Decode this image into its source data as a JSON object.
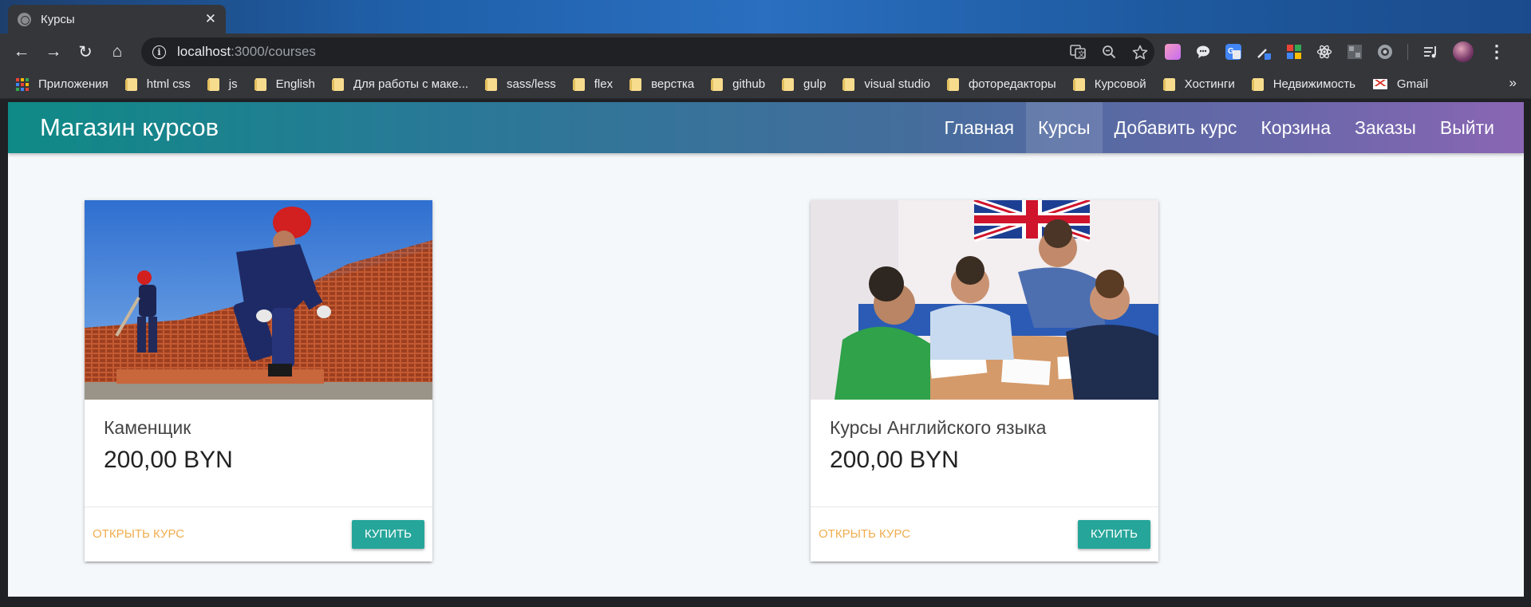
{
  "browser": {
    "tab": {
      "title": "Курсы",
      "close_glyph": "✕",
      "favicon": "globe-icon"
    },
    "nav": {
      "back": "←",
      "forward": "→",
      "reload": "↻",
      "home": "⌂"
    },
    "url": {
      "host": "localhost",
      "path": ":3000/courses"
    },
    "omnibox_icons": [
      "translate-icon",
      "zoom-icon",
      "star-icon"
    ],
    "extensions": [
      "gradient-extension-icon",
      "chat-extension-icon",
      "translate-extension-icon",
      "eyedropper-extension-icon",
      "grid-extension-icon",
      "react-devtools-icon",
      "layout-extension-icon",
      "circle-extension-icon"
    ],
    "bookmarks": [
      {
        "label": "Приложения",
        "type": "apps"
      },
      {
        "label": "html css",
        "type": "folder"
      },
      {
        "label": "js",
        "type": "folder"
      },
      {
        "label": "English",
        "type": "folder"
      },
      {
        "label": "Для работы с маке...",
        "type": "folder"
      },
      {
        "label": "sass/less",
        "type": "folder"
      },
      {
        "label": "flex",
        "type": "folder"
      },
      {
        "label": "верстка",
        "type": "folder"
      },
      {
        "label": "github",
        "type": "folder"
      },
      {
        "label": "gulp",
        "type": "folder"
      },
      {
        "label": "visual studio",
        "type": "folder"
      },
      {
        "label": "фоторедакторы",
        "type": "folder"
      },
      {
        "label": "Курсовой",
        "type": "folder"
      },
      {
        "label": "Хостинги",
        "type": "folder"
      },
      {
        "label": "Недвижимость",
        "type": "folder"
      },
      {
        "label": "Gmail",
        "type": "gmail"
      }
    ],
    "bookmarks_more": "»"
  },
  "navbar": {
    "brand": "Магазин курсов",
    "links": [
      {
        "label": "Главная",
        "active": false
      },
      {
        "label": "Курсы",
        "active": true
      },
      {
        "label": "Добавить курс",
        "active": false
      },
      {
        "label": "Корзина",
        "active": false
      },
      {
        "label": "Заказы",
        "active": false
      },
      {
        "label": "Выйти",
        "active": false
      }
    ]
  },
  "courses": [
    {
      "title": "Каменщик",
      "price": "200,00 BYN",
      "open_label": "Открыть курс",
      "buy_label": "Купить",
      "image": "bricklayers-photo"
    },
    {
      "title": "Курсы Английского языка",
      "price": "200,00 BYN",
      "open_label": "Открыть курс",
      "buy_label": "Купить",
      "image": "english-class-photo"
    }
  ],
  "colors": {
    "accent": "#26a69a",
    "link": "#f0ad4e",
    "navbar_start": "#0f8a86",
    "navbar_end": "#8a66b4"
  }
}
